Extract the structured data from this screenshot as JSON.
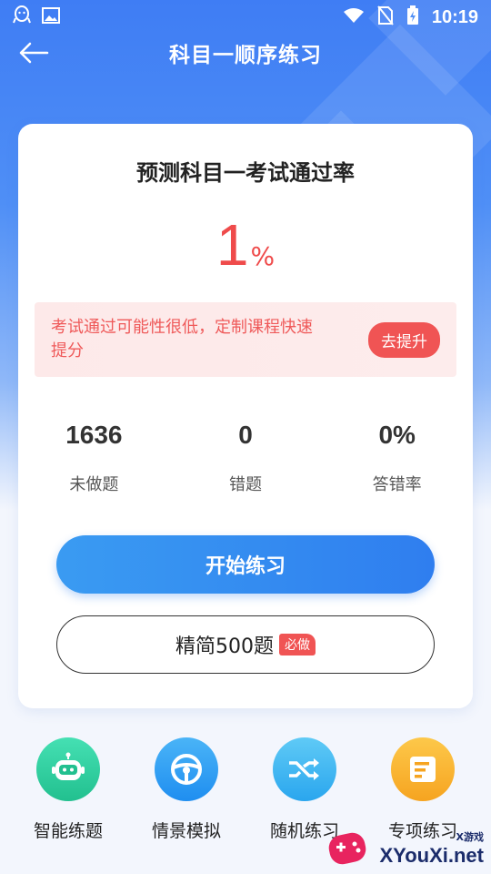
{
  "status_bar": {
    "time": "10:19"
  },
  "nav": {
    "title": "科目一顺序练习"
  },
  "card": {
    "title": "预测科目一考试通过率",
    "pass_rate_value": "1",
    "pass_rate_unit": "%",
    "tip_text": "考试通过可能性很低，定制课程快速提分",
    "tip_button": "去提升",
    "stats": [
      {
        "value": "1636",
        "label": "未做题"
      },
      {
        "value": "0",
        "label": "错题"
      },
      {
        "value": "0%",
        "label": "答错率"
      }
    ],
    "start_button": "开始练习",
    "jingjian_button": "精简500题",
    "must_badge": "必做"
  },
  "quick_actions": [
    {
      "label": "智能练题",
      "icon": "robot-icon",
      "color": "#2fd3a2"
    },
    {
      "label": "情景模拟",
      "icon": "steering-wheel-icon",
      "color": "#2e9df4"
    },
    {
      "label": "随机练习",
      "icon": "shuffle-icon",
      "color": "#3bb8f0"
    },
    {
      "label": "专项练习",
      "icon": "document-icon",
      "color": "#f8b62c"
    }
  ],
  "watermark": {
    "brand_cn": "X游戏",
    "brand_en": "XYouXi.net"
  },
  "colors": {
    "primary": "#2f7eef",
    "accent_red": "#ef4b4b"
  }
}
